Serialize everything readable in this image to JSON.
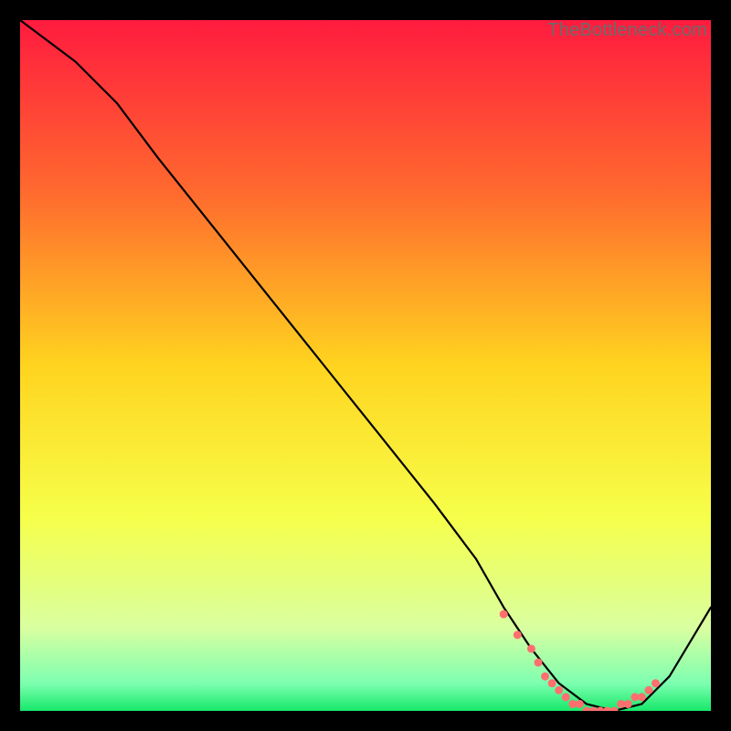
{
  "watermark": "TheBottleneck.com",
  "chart_data": {
    "type": "line",
    "title": "",
    "xlabel": "",
    "ylabel": "",
    "xlim": [
      0,
      100
    ],
    "ylim": [
      0,
      100
    ],
    "grid": false,
    "gradient_stops": [
      {
        "offset": 0,
        "color": "#ff1b3f"
      },
      {
        "offset": 25,
        "color": "#ff6a2e"
      },
      {
        "offset": 50,
        "color": "#ffd41f"
      },
      {
        "offset": 72,
        "color": "#f6ff4a"
      },
      {
        "offset": 88,
        "color": "#d9ffa0"
      },
      {
        "offset": 96,
        "color": "#7dffb0"
      },
      {
        "offset": 100,
        "color": "#17e86a"
      }
    ],
    "series": [
      {
        "name": "bottleneck-curve",
        "color": "#000000",
        "x": [
          0,
          8,
          14,
          20,
          28,
          36,
          44,
          52,
          60,
          66,
          70,
          74,
          78,
          82,
          86,
          90,
          94,
          100
        ],
        "y": [
          100,
          94,
          88,
          80,
          70,
          60,
          50,
          40,
          30,
          22,
          15,
          9,
          4,
          1,
          0,
          1,
          5,
          15
        ]
      }
    ],
    "markers": {
      "name": "optimal-range-dots",
      "color": "#ff6f6f",
      "x": [
        70,
        72,
        74,
        75,
        76,
        77,
        78,
        79,
        80,
        81,
        82,
        83,
        84,
        85,
        86,
        87,
        88,
        89,
        90,
        91,
        92
      ],
      "y": [
        14,
        11,
        9,
        7,
        5,
        4,
        3,
        2,
        1,
        1,
        0,
        0,
        0,
        0,
        0,
        1,
        1,
        2,
        2,
        3,
        4
      ]
    }
  }
}
